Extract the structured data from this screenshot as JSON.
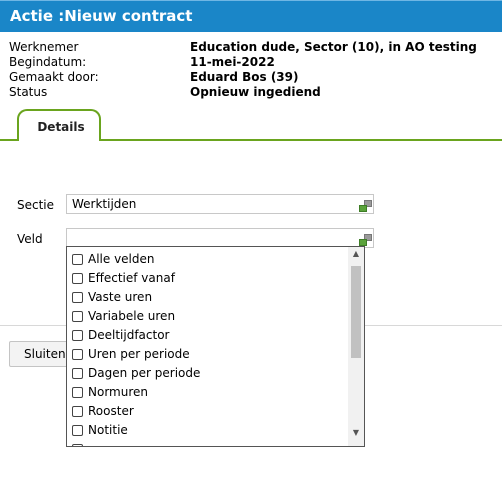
{
  "window": {
    "title": "Actie :Nieuw contract"
  },
  "info": {
    "rows": [
      {
        "label": "Werknemer",
        "value": "Education dude, Sector (10), in AO testing"
      },
      {
        "label": "Begindatum:",
        "value": "11-mei-2022"
      },
      {
        "label": "Gemaakt door:",
        "value": "Eduard Bos (39)"
      },
      {
        "label": "Status",
        "value": "Opnieuw ingediend"
      }
    ]
  },
  "tabs": [
    {
      "label": "Details"
    }
  ],
  "form": {
    "sectie": {
      "label": "Sectie",
      "value": "Werktijden"
    },
    "veld": {
      "label": "Veld",
      "value": ""
    }
  },
  "dropdown": {
    "items": [
      {
        "label": "Alle velden",
        "checked": false
      },
      {
        "label": "Effectief vanaf",
        "checked": false
      },
      {
        "label": "Vaste uren",
        "checked": false
      },
      {
        "label": "Variabele uren",
        "checked": false
      },
      {
        "label": "Deeltijdfactor",
        "checked": false
      },
      {
        "label": "Uren per periode",
        "checked": false
      },
      {
        "label": "Dagen per periode",
        "checked": false
      },
      {
        "label": "Normuren",
        "checked": false
      },
      {
        "label": "Rooster",
        "checked": false
      },
      {
        "label": "Notitie",
        "checked": false
      }
    ]
  },
  "buttons": {
    "close": "Sluiten"
  },
  "colors": {
    "titlebar": "#1a86c8",
    "tab_accent": "#6aa41e"
  }
}
